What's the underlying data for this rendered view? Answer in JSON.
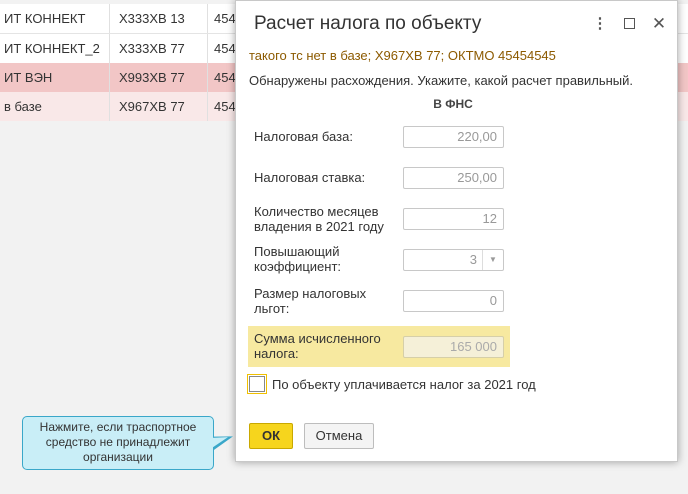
{
  "table": {
    "rows": [
      {
        "col1": "ИТ КОННЕКТ",
        "col2": "Х333ХВ 13",
        "col3": "454"
      },
      {
        "col1": "ИТ КОННЕКТ_2",
        "col2": "Х333ХВ 77",
        "col3": "454"
      },
      {
        "col1": "ИТ ВЭН",
        "col2": "Х993ХВ 77",
        "col3": "454"
      },
      {
        "col1": "в базе",
        "col2": "Х967ХВ 77",
        "col3": "454"
      }
    ],
    "row_colors": [
      "#ffffff",
      "#ffffff",
      "#f2c6c6",
      "#f9e8e8"
    ]
  },
  "dialog": {
    "title": "Расчет налога по объекту",
    "warning": "такого тс нет в базе; Х967ХВ 77; ОКТМО 45454545",
    "info": "Обнаружены расхождения. Укажите, какой расчет правильный.",
    "column_header": "В ФНС",
    "fields": {
      "tax_base": {
        "label": "Налоговая база:",
        "value": "220,00"
      },
      "tax_rate": {
        "label": "Налоговая ставка:",
        "value": "250,00"
      },
      "months": {
        "label1": "Количество месяцев",
        "label2": "владения в 2021 году",
        "value": "12"
      },
      "coef": {
        "label1": "Повышающий",
        "label2": "коэффициент:",
        "value": "3"
      },
      "benefits": {
        "label1": "Размер налоговых",
        "label2": "льгот:",
        "value": "0"
      },
      "total": {
        "label1": "Сумма исчисленного",
        "label2": "налога:",
        "value": "165 000"
      }
    },
    "checkbox_label": "По объекту уплачивается налог за 2021 год",
    "ok_label": "ОК",
    "cancel_label": "Отмена"
  },
  "tooltip": {
    "line1": "Нажмите, если траспортное",
    "line2": "средство не принадлежит",
    "line3": "организации"
  },
  "icons": {
    "menu": "more-vertical-icon",
    "maximize": "maximize-icon",
    "close": "close-icon",
    "combo": "chevron-down-icon"
  },
  "colors": {
    "accent": "#f6d51d",
    "warning_text": "#8c5a00",
    "highlight": "#f7e9a0",
    "tooltip_bg": "#c9eef7",
    "tooltip_border": "#3aa7c9"
  }
}
